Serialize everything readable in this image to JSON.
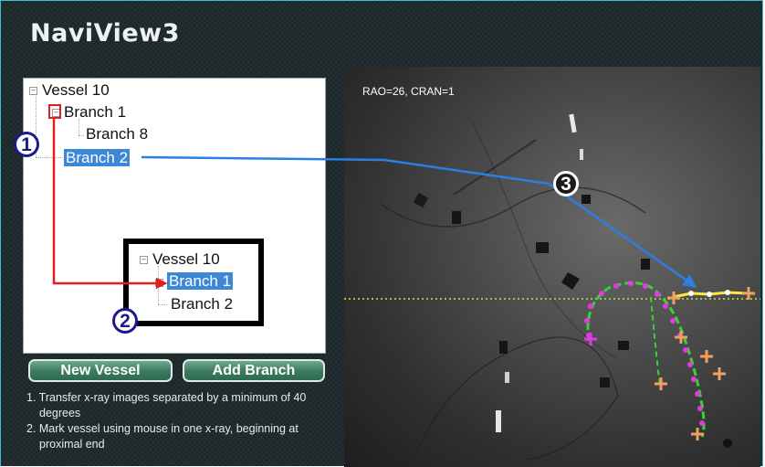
{
  "app": {
    "title": "NaviView3"
  },
  "tree": {
    "items": [
      {
        "label": "Vessel 10",
        "selected": false
      },
      {
        "label": "Branch 1",
        "selected": false
      },
      {
        "label": "Branch 8",
        "selected": false
      },
      {
        "label": "Branch 2",
        "selected": true
      }
    ]
  },
  "callout": {
    "items": [
      {
        "label": "Vessel 10",
        "selected": false
      },
      {
        "label": "Branch 1",
        "selected": true
      },
      {
        "label": "Branch 2",
        "selected": false
      }
    ]
  },
  "steps": {
    "one": "1",
    "two": "2",
    "three": "3"
  },
  "buttons": {
    "new_vessel": "New Vessel",
    "add_branch": "Add Branch"
  },
  "instructions": [
    {
      "text": "1. Transfer x-ray images separated by a minimum of 40 degrees"
    },
    {
      "text": "2. Mark vessel using mouse in one x-ray, beginning at proximal end"
    }
  ],
  "xray": {
    "view_label": "RAO=26, CRAN=1"
  },
  "colors": {
    "frame_border": "#38c4cc",
    "selection": "#3d88d6",
    "arrow_blue": "#2b7fe0",
    "arrow_red": "#e02020",
    "vessel_green": "#38d238",
    "vessel_magenta": "#e23ae2",
    "branch_yellow": "#ffe640",
    "marker_orange": "#f0a060"
  }
}
